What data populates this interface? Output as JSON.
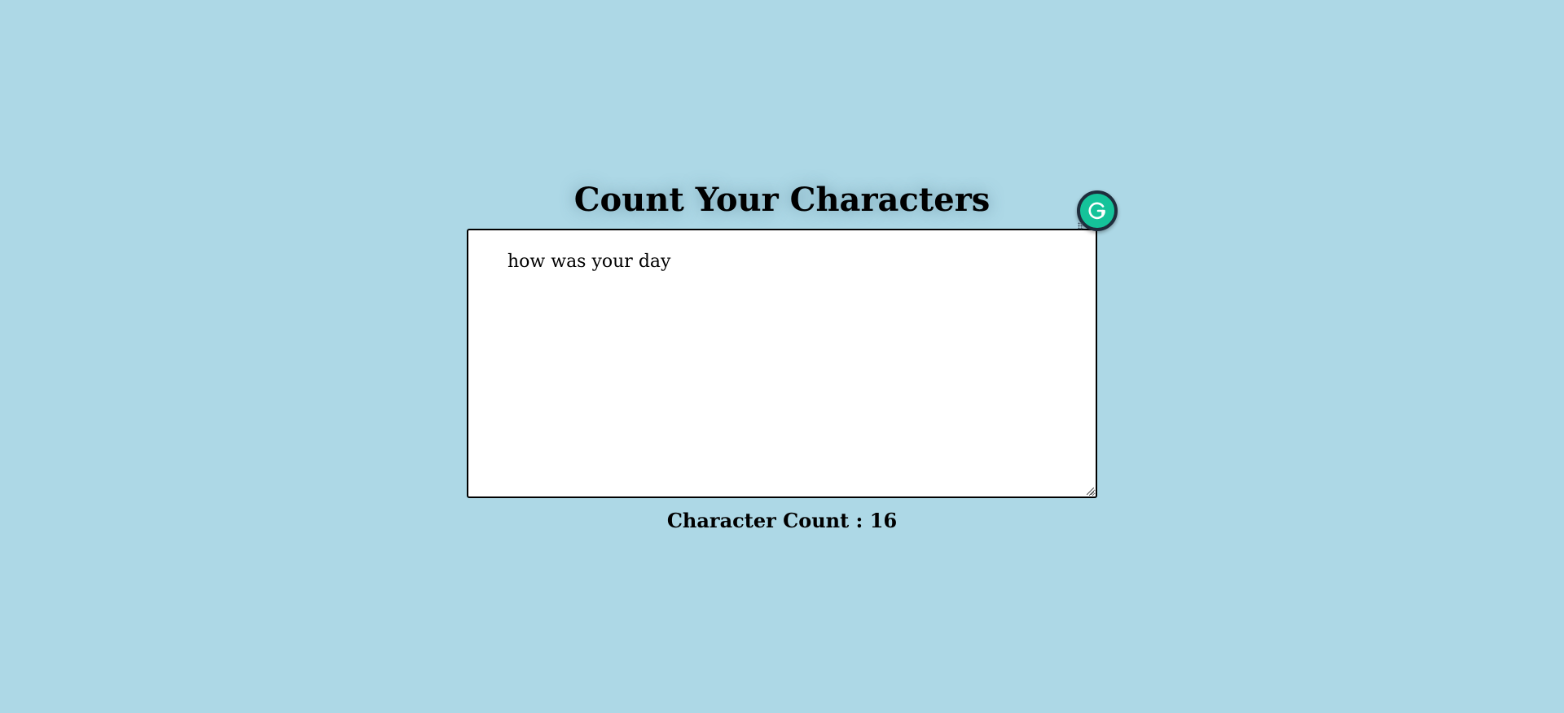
{
  "page": {
    "title": "Count Your Characters",
    "background_color": "#add8e6"
  },
  "editor": {
    "value": "how was your day",
    "placeholder": ""
  },
  "counter": {
    "label": "Character Count : ",
    "count": "16"
  },
  "grammarly": {
    "icon": "grammarly-icon",
    "color": "#15c39a"
  }
}
